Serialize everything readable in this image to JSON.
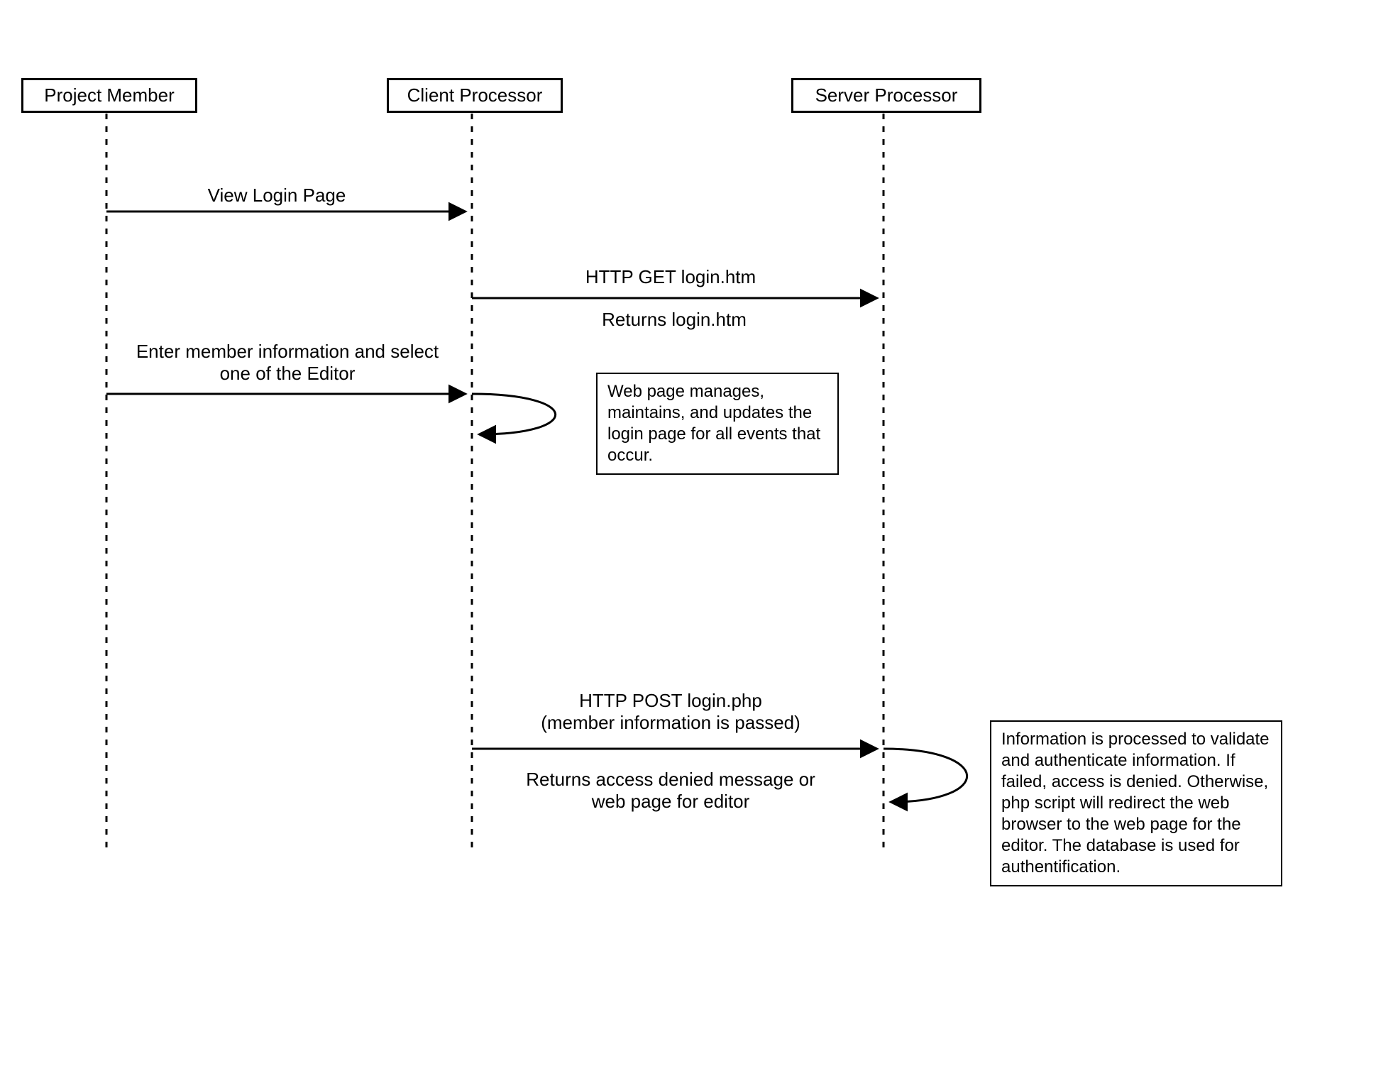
{
  "actors": {
    "project_member": "Project Member",
    "client_processor": "Client Processor",
    "server_processor": "Server Processor"
  },
  "messages": {
    "view_login": "View Login Page",
    "http_get": "HTTP GET login.htm",
    "returns_login": "Returns login.htm",
    "enter_info": "Enter member information and select\none of the Editor",
    "http_post": "HTTP POST login.php\n(member information is passed)",
    "returns_access": "Returns access denied message or\nweb page for editor"
  },
  "notes": {
    "client_note": "Web page manages, maintains, and updates the login page for all events that occur.",
    "server_note": "Information is processed to validate and authenticate information.  If failed, access is denied.  Otherwise, php script will redirect the web browser to the web page for the editor.  The database is used for authentification."
  }
}
